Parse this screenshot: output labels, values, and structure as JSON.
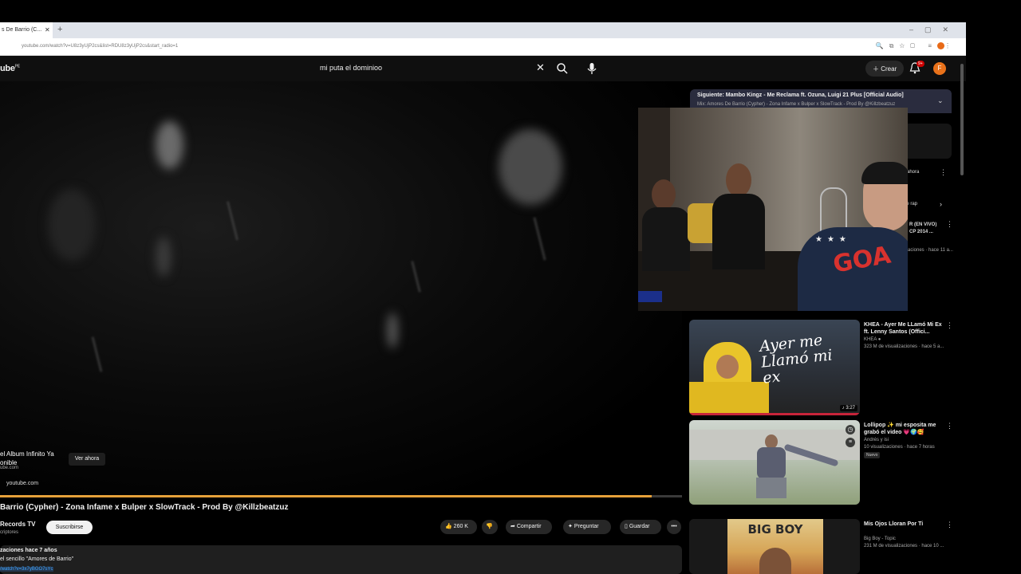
{
  "browser": {
    "tab_title": "s De Barrio (C...",
    "url": "youtube.com/watch?v=U8z3yUjP2cs&list=RDU8z3yUjP2cs&start_radio=1"
  },
  "header": {
    "logo": "ube",
    "logo_region": "PE",
    "search_query": "mi puta el dominioo",
    "create_label": "Crear",
    "notif_count": "9+",
    "avatar_letter": "F"
  },
  "player": {
    "promo_title": "el Album Infinito Ya\nonible",
    "promo_sub": "ube.com",
    "watch_now": "Ver ahora",
    "domain": "youtube.com",
    "progress": 0.955
  },
  "video": {
    "title": "Barrio (Cypher) - Zona Infame x Bulper x SlowTrack - Prod By @Killzbeatzuz",
    "channel": "Records TV",
    "subs": "criptores",
    "subscribe": "Suscribirse",
    "likes": "260 K",
    "share": "Compartir",
    "ask": "Preguntar",
    "save": "Guardar",
    "desc_line1": "zaciones  hace 7 años",
    "desc_line2": "el sencillo \"Amores de Barrio\"",
    "desc_link": "/watch?v=3x7yBGO7sYc"
  },
  "mix": {
    "next": "Siguiente: Mambo Kingz - Me Reclama ft. Ozuna, Luigi 21 Plus [Official Audio]",
    "sub": "Mix: Amores De Barrio (Cypher) - Zona Infame x Bulper x SlowTrack - Prod By @Killzbeatzuz",
    "partial_ahora": "ahora",
    "partial_rap": "de rap",
    "partial_vivo": "R (EN VIVO)\nCP 2014 ...",
    "partial_meta": "aciones · hace 11 a..."
  },
  "recommendations": [
    {
      "title": "KHEA - Ayer Me LLamó Mi Ex ft. Lenny Santos (Offici...",
      "channel": "KHEA",
      "meta": "323 M de visualizaciones · hace 5 a...",
      "duration": "3:27",
      "thumb_text": "Ayer me Llamó mi ex"
    },
    {
      "title": "Lollipop ✨ mi esposita me grabó el video 💗🌍🥰",
      "channel": "Andrés y isi",
      "meta": "10 visualizaciones · hace 7 horas",
      "badge": "Nuevo"
    },
    {
      "title": "Mis Ojos Lloran Por Ti",
      "channel": "Big Boy - Topic",
      "meta": "231 M de visualizaciones · hace 10 ...",
      "thumb_text": "BIG BOY"
    }
  ],
  "colors": {
    "progress": "#e6a13a",
    "mix_bg": "#2a2c3e",
    "avatar": "#e8711a",
    "khea_yellow": "#e9c42a"
  }
}
